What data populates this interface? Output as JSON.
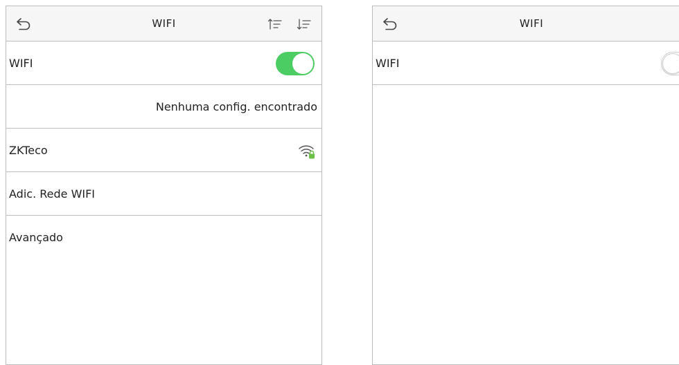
{
  "left_screen": {
    "title": "WIFI",
    "wifi_row": {
      "label": "WIFI",
      "enabled": true
    },
    "status_text": "Nenhuma config. encontrado",
    "networks": [
      {
        "name": "ZKTeco",
        "icon": "wifi-locked-icon"
      }
    ],
    "add_network_label": "Adic. Rede WIFI",
    "advanced_label": "Avançado"
  },
  "right_screen": {
    "title": "WIFI",
    "wifi_row": {
      "label": "WIFI",
      "enabled": false
    }
  },
  "colors": {
    "toggle_on": "#4ccd64",
    "lock_badge": "#6cc04a",
    "divider": "#bdbdbd",
    "header_bg": "#f6f6f6"
  }
}
